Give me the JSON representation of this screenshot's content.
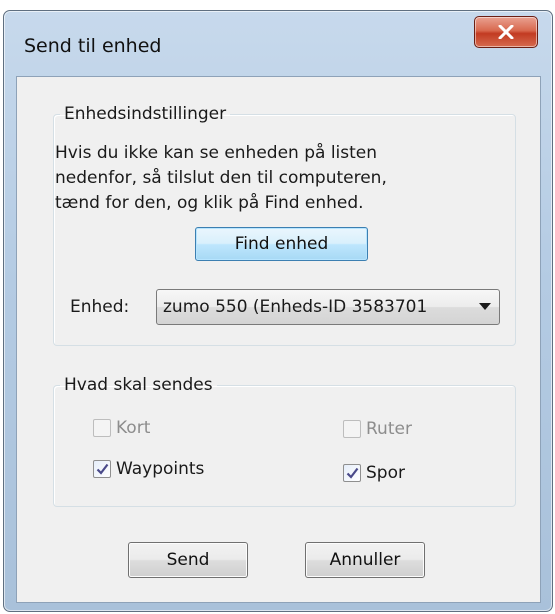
{
  "window": {
    "title": "Send til enhed"
  },
  "device_settings": {
    "legend": "Enhedsindstillinger",
    "info_lines": [
      "Hvis du ikke kan se enheden på listen",
      "nedenfor, så tilslut den til computeren,",
      "tænd for den, og klik på Find enhed."
    ],
    "find_button": "Find enhed",
    "device_label": "Enhed:",
    "device_value": "zumo 550 (Enheds-ID 3583701"
  },
  "send_what": {
    "legend": "Hvad skal sendes",
    "options": [
      {
        "label": "Kort",
        "checked": false,
        "disabled": true
      },
      {
        "label": "Ruter",
        "checked": false,
        "disabled": true
      },
      {
        "label": "Waypoints",
        "checked": true,
        "disabled": false
      },
      {
        "label": "Spor",
        "checked": true,
        "disabled": false
      }
    ]
  },
  "buttons": {
    "send": "Send",
    "cancel": "Annuller"
  },
  "colors": {
    "titlebar": "#b4cbe3",
    "close_button": "#c23b22",
    "check_mark": "#4a4a8a"
  },
  "icons": {
    "close": "close-icon",
    "dropdown": "chevron-down-icon",
    "check": "check-icon"
  }
}
